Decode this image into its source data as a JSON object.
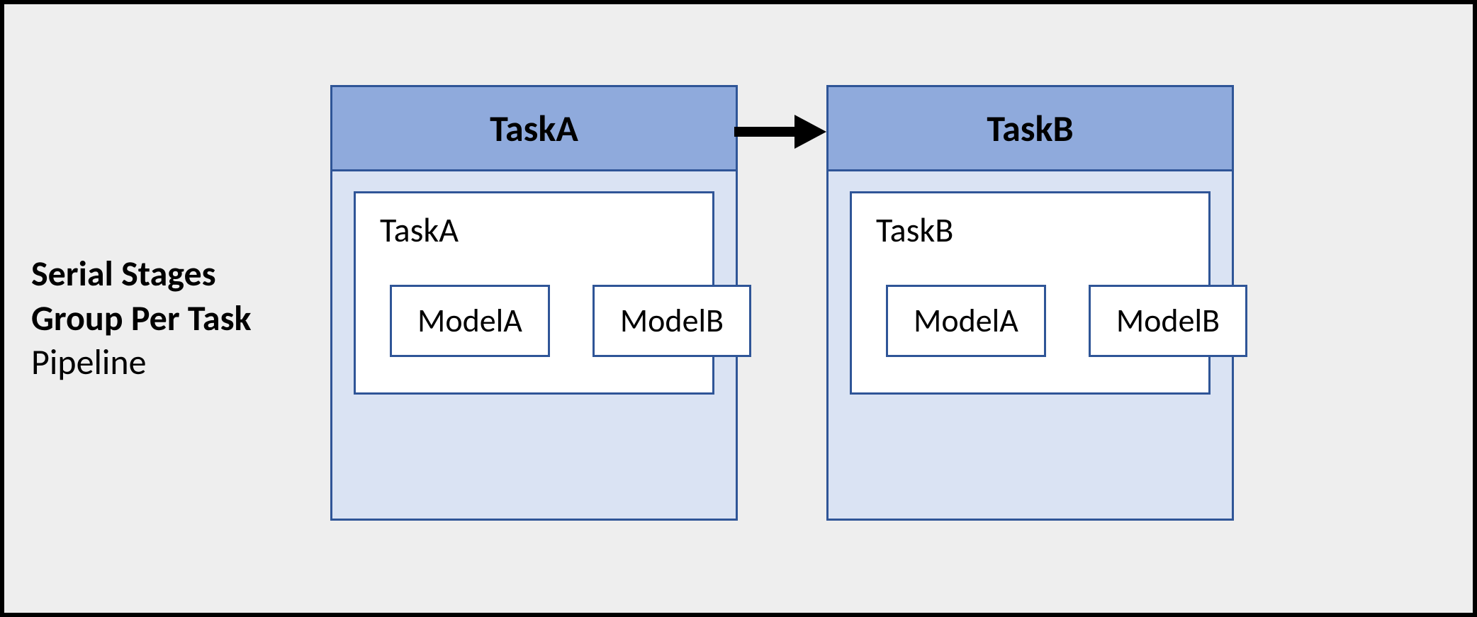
{
  "caption": {
    "line1": "Serial Stages",
    "line2": "Group Per Task",
    "line3": "Pipeline"
  },
  "stages": [
    {
      "header": "TaskA",
      "inner_title": "TaskA",
      "models": [
        "ModelA",
        "ModelB"
      ]
    },
    {
      "header": "TaskB",
      "inner_title": "TaskB",
      "models": [
        "ModelA",
        "ModelB"
      ]
    }
  ]
}
